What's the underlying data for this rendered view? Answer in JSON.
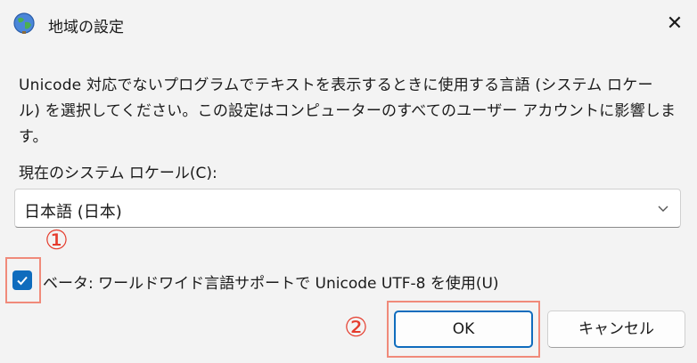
{
  "dialog": {
    "title": "地域の設定",
    "close_glyph": "✕",
    "icon": "globe-icon"
  },
  "description": {
    "line1": "Unicode 対応でないプログラムでテキストを表示するときに使用する言語 (システム ロケー",
    "line2": "ル) を選択してください。この設定はコンピューターのすべてのユーザー アカウントに影響しま",
    "line3": "す。"
  },
  "locale": {
    "label": "現在のシステム ロケール(C):",
    "selected": "日本語 (日本)"
  },
  "beta": {
    "checked": true,
    "label": "ベータ: ワールドワイド言語サポートで Unicode UTF-8 を使用(U)"
  },
  "annotations": {
    "marker1": "①",
    "marker2": "②",
    "highlight_color": "#f08a7a",
    "marker_color": "#e53b2c"
  },
  "buttons": {
    "ok": "OK",
    "cancel": "キャンセル"
  },
  "colors": {
    "accent": "#0f6cbd",
    "background": "#f3f3f3"
  }
}
